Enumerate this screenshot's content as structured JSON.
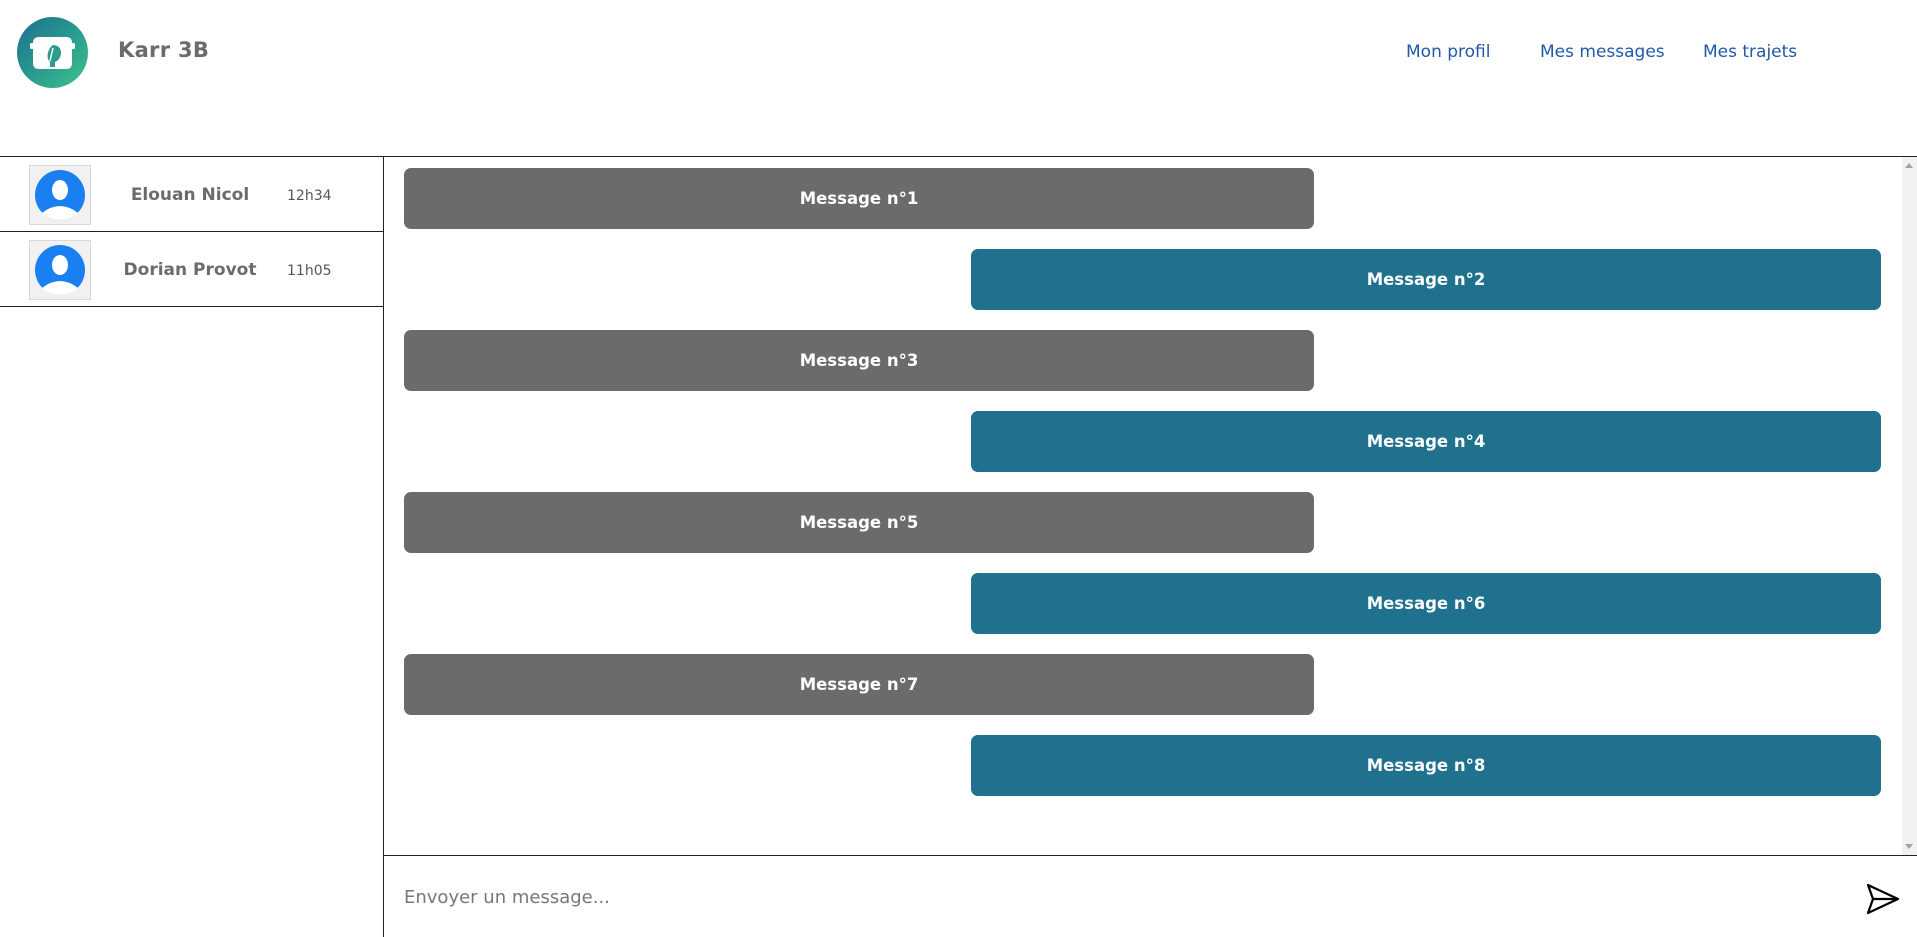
{
  "header": {
    "brand": "Karr 3B",
    "nav": {
      "profile": "Mon profil",
      "messages": "Mes messages",
      "trips": "Mes trajets"
    }
  },
  "contacts": [
    {
      "name": "Elouan Nicol",
      "time": "12h34"
    },
    {
      "name": "Dorian Provot",
      "time": "11h05"
    }
  ],
  "messages": [
    {
      "text": "Message n°1",
      "direction": "received"
    },
    {
      "text": "Message n°2",
      "direction": "sent"
    },
    {
      "text": "Message n°3",
      "direction": "received"
    },
    {
      "text": "Message n°4",
      "direction": "sent"
    },
    {
      "text": "Message n°5",
      "direction": "received"
    },
    {
      "text": "Message n°6",
      "direction": "sent"
    },
    {
      "text": "Message n°7",
      "direction": "received"
    },
    {
      "text": "Message n°8",
      "direction": "sent"
    }
  ],
  "composer": {
    "placeholder": "Envoyer un message..."
  },
  "icons": {
    "logo": "car-leaf-logo-icon",
    "avatar": "user-avatar-icon",
    "send": "send-icon"
  },
  "colors": {
    "received_bubble": "#6b6b6b",
    "sent_bubble": "#1f718d",
    "nav_link": "#1f5aa8",
    "logo_gradient_start": "#1e6f8e",
    "logo_gradient_end": "#3fc38a"
  }
}
